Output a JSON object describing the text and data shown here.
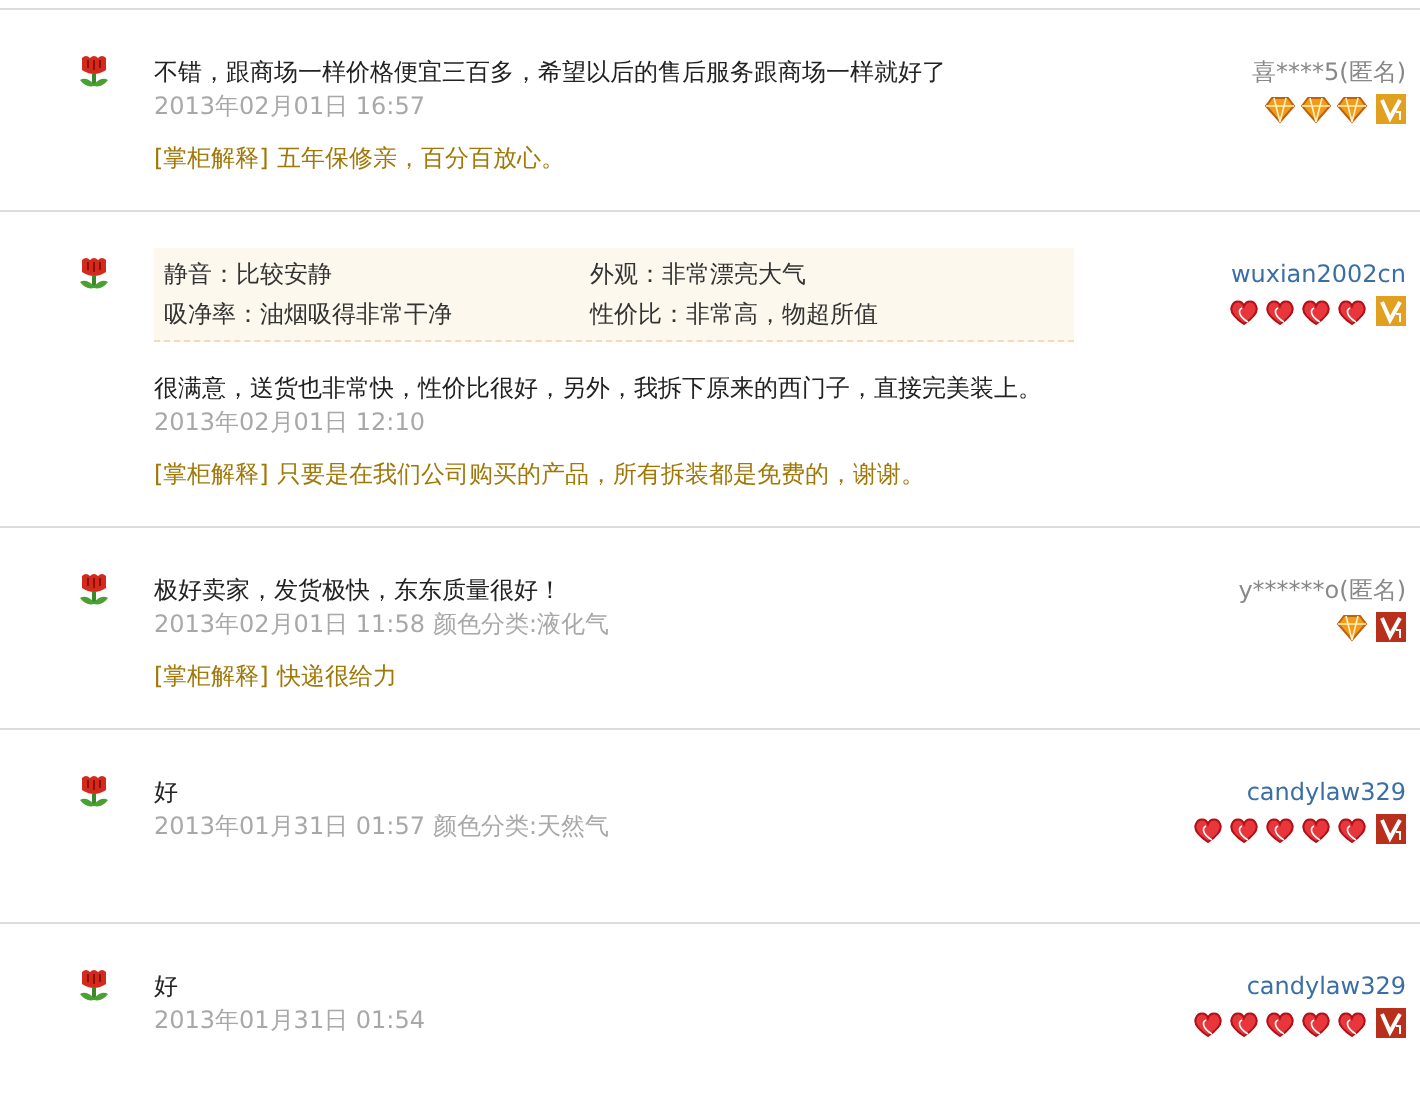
{
  "reviews": [
    {
      "text": "不错，跟商场一样价格便宜三百多，希望以后的售后服务跟商场一样就好了",
      "date": "2013年02月01日 16:57",
      "reply": {
        "label": "[掌柜解释]",
        "text": "五年保修亲，百分百放心。"
      },
      "user": {
        "name": "喜****5(匿名)",
        "kind": "anonymous"
      },
      "rank_icons": [
        {
          "kind": "diamond"
        },
        {
          "kind": "diamond"
        },
        {
          "kind": "diamond"
        }
      ],
      "vip": {
        "color": "#e2a020"
      }
    },
    {
      "attributes": [
        {
          "text": "静音：比较安静"
        },
        {
          "text": "外观：非常漂亮大气"
        },
        {
          "text": "吸净率：油烟吸得非常干净"
        },
        {
          "text": "性价比：非常高，物超所值"
        }
      ],
      "text": "很满意，送货也非常快，性价比很好，另外，我拆下原来的西门子，直接完美装上。",
      "date": "2013年02月01日 12:10",
      "reply": {
        "label": "[掌柜解释]",
        "text": "只要是在我们公司购买的产品，所有拆装都是免费的，谢谢。"
      },
      "user": {
        "name": "wuxian2002cn",
        "kind": "member"
      },
      "rank_icons": [
        {
          "kind": "heart"
        },
        {
          "kind": "heart"
        },
        {
          "kind": "heart"
        },
        {
          "kind": "heart"
        }
      ],
      "vip": {
        "color": "#e2a020"
      }
    },
    {
      "text": "极好卖家，发货极快，东东质量很好！",
      "date": "2013年02月01日 11:58",
      "category": "颜色分类:液化气",
      "reply": {
        "label": "[掌柜解释]",
        "text": "快递很给力"
      },
      "user": {
        "name": "y******o(匿名)",
        "kind": "anonymous"
      },
      "rank_icons": [
        {
          "kind": "diamond"
        }
      ],
      "vip": {
        "color": "#b8301c"
      }
    },
    {
      "text": "好",
      "date": "2013年01月31日 01:57",
      "category": "颜色分类:天然气",
      "user": {
        "name": "candylaw329",
        "kind": "member"
      },
      "rank_icons": [
        {
          "kind": "heart"
        },
        {
          "kind": "heart"
        },
        {
          "kind": "heart"
        },
        {
          "kind": "heart"
        },
        {
          "kind": "heart"
        }
      ],
      "vip": {
        "color": "#b8301c"
      }
    },
    {
      "text": "好",
      "date": "2013年01月31日 01:54",
      "user": {
        "name": "candylaw329",
        "kind": "member"
      },
      "rank_icons": [
        {
          "kind": "heart"
        },
        {
          "kind": "heart"
        },
        {
          "kind": "heart"
        },
        {
          "kind": "heart"
        },
        {
          "kind": "heart"
        }
      ],
      "vip": {
        "color": "#b8301c"
      }
    }
  ]
}
